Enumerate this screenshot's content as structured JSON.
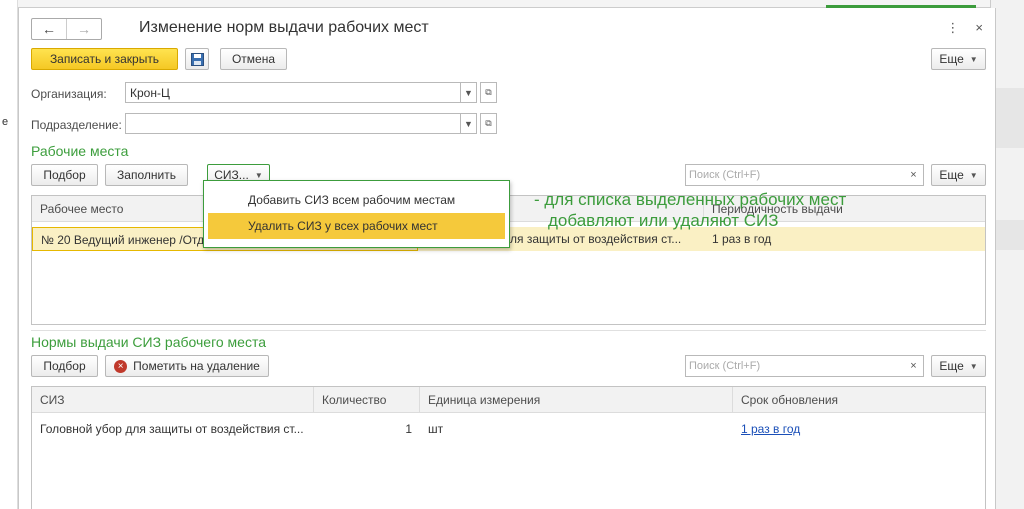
{
  "window": {
    "title": "Изменение норм выдачи рабочих мест",
    "nav_back": "←",
    "nav_forward": "→",
    "more_icon": "⋮",
    "close_icon": "×"
  },
  "toolbar": {
    "save_close": "Записать и закрыть",
    "cancel": "Отмена",
    "more": "Еще"
  },
  "form": {
    "org_label": "Организация:",
    "org_value": "Крон-Ц",
    "dept_label": "Подразделение:",
    "dept_value": ""
  },
  "workplaces": {
    "title": "Рабочие места",
    "btn_pick": "Подбор",
    "btn_fill": "Заполнить",
    "btn_siz": "СИЗ...",
    "search_placeholder": "Поиск (Ctrl+F)",
    "more": "Еще",
    "columns": [
      "Рабочее место",
      "",
      "Периодичность выдачи"
    ],
    "rows": [
      {
        "workplace": "№ 20 Ведущий инженер /Отде",
        "siz": "ля защиты от воздействия ст...",
        "period": "1 раз в год"
      }
    ]
  },
  "siz_menu": {
    "items": [
      "Добавить СИЗ всем рабочим местам",
      "Удалить СИЗ у всех рабочих мест"
    ]
  },
  "annotation": {
    "line1": "- для списка выделенных рабочих мест",
    "line2": "добавляют или удаляют СИЗ"
  },
  "norms": {
    "title": "Нормы выдачи СИЗ рабочего места",
    "btn_pick": "Подбор",
    "btn_mark_delete": "Пометить на удаление",
    "search_placeholder": "Поиск (Ctrl+F)",
    "more": "Еще",
    "columns": [
      "СИЗ",
      "Количество",
      "Единица измерения",
      "Срок обновления"
    ],
    "rows": [
      {
        "siz": "Головной убор для защиты от воздействия ст...",
        "qty": "1",
        "unit": "шт",
        "period": "1 раз в год"
      }
    ]
  },
  "background": {
    "left_fragment": "е"
  },
  "colors": {
    "accent_green": "#3c9c3c",
    "primary_yellow": "#f5c824",
    "selected_row": "#faf0c4"
  }
}
